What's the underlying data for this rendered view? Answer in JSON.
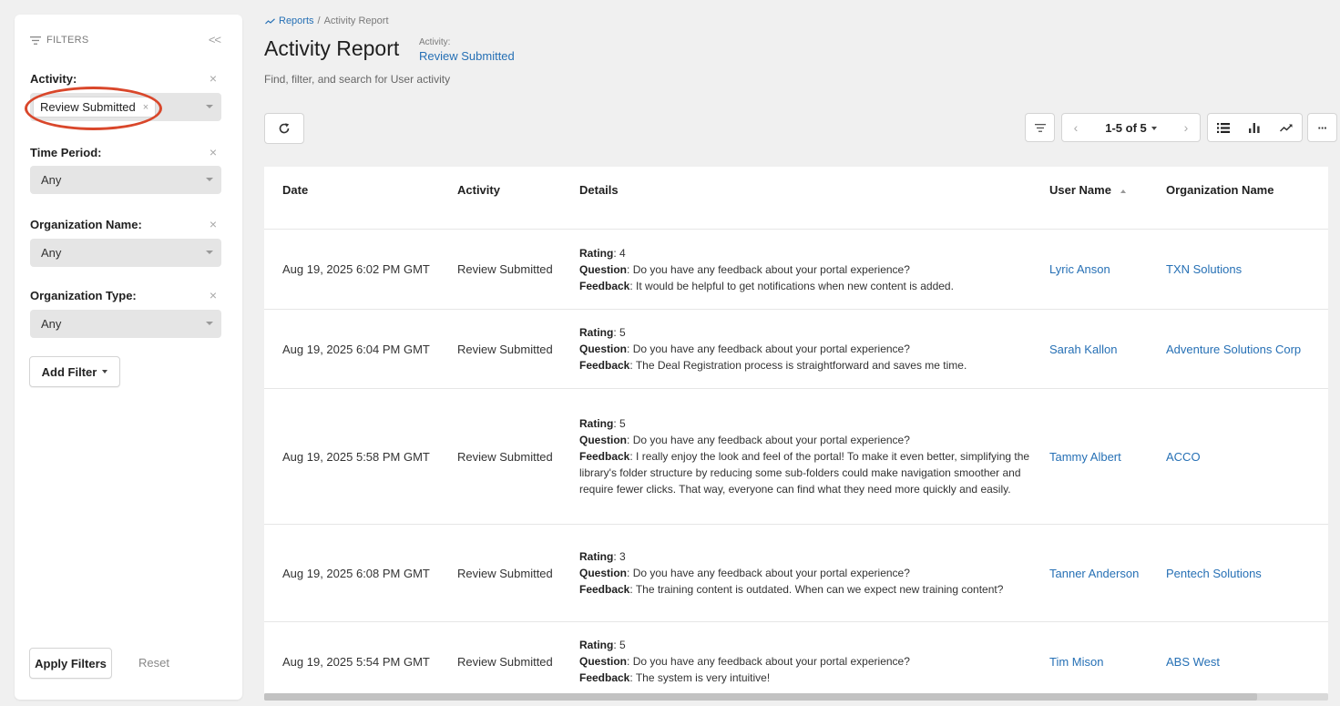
{
  "sidebar": {
    "header": "FILTERS",
    "collapse": "<<",
    "filters": [
      {
        "label": "Activity:",
        "chip": "Review Submitted"
      },
      {
        "label": "Time Period:",
        "value": "Any"
      },
      {
        "label": "Organization Name:",
        "value": "Any"
      },
      {
        "label": "Organization Type:",
        "value": "Any"
      }
    ],
    "close_glyph": "×",
    "add_filter": "Add Filter",
    "apply": "Apply Filters",
    "reset": "Reset"
  },
  "header": {
    "breadcrumb_parent": "Reports",
    "breadcrumb_sep": "/",
    "breadcrumb_current": "Activity Report",
    "title": "Activity Report",
    "subtitle_label": "Activity:",
    "subtitle_value": "Review Submitted",
    "description": "Find, filter, and search for User activity"
  },
  "toolbar": {
    "range": "1-5 of 5",
    "prev": "‹",
    "next": "›",
    "more": "···"
  },
  "table": {
    "columns": [
      "Date",
      "Activity",
      "Details",
      "User Name",
      "Organization Name"
    ],
    "detail_labels": {
      "rating": "Rating",
      "question": "Question",
      "feedback": "Feedback"
    },
    "rows": [
      {
        "date": "Aug 19, 2025 6:02 PM GMT",
        "activity": "Review Submitted",
        "rating": "4",
        "question": "Do you have any feedback about your portal experience?",
        "feedback": "It would be helpful to get notifications when new content is added.",
        "user": "Lyric Anson",
        "org": "TXN Solutions"
      },
      {
        "date": "Aug 19, 2025 6:04 PM GMT",
        "activity": "Review Submitted",
        "rating": "5",
        "question": "Do you have any feedback about your portal experience?",
        "feedback": "The Deal Registration process is straightforward and saves me time.",
        "user": "Sarah Kallon",
        "org": "Adventure Solutions Corp"
      },
      {
        "date": "Aug 19, 2025 5:58 PM GMT",
        "activity": "Review Submitted",
        "rating": "5",
        "question": "Do you have any feedback about your portal experience?",
        "feedback": "I really enjoy the look and feel of the portal! To make it even better, simplifying the library's folder structure by reducing some sub-folders could make navigation smoother and require fewer clicks. That way, everyone can find what they need more quickly and easily.",
        "user": "Tammy Albert",
        "org": "ACCO"
      },
      {
        "date": "Aug 19, 2025 6:08 PM GMT",
        "activity": "Review Submitted",
        "rating": "3",
        "question": "Do you have any feedback about your portal experience?",
        "feedback": "The training content is outdated. When can we expect new training content?",
        "user": "Tanner Anderson",
        "org": "Pentech Solutions"
      },
      {
        "date": "Aug 19, 2025 5:54 PM GMT",
        "activity": "Review Submitted",
        "rating": "5",
        "question": "Do you have any feedback about your portal experience?",
        "feedback": "The system is very intuitive!",
        "user": "Tim Mison",
        "org": "ABS West"
      }
    ]
  },
  "colors": {
    "link": "#2670b5",
    "highlight": "#d9472b"
  }
}
